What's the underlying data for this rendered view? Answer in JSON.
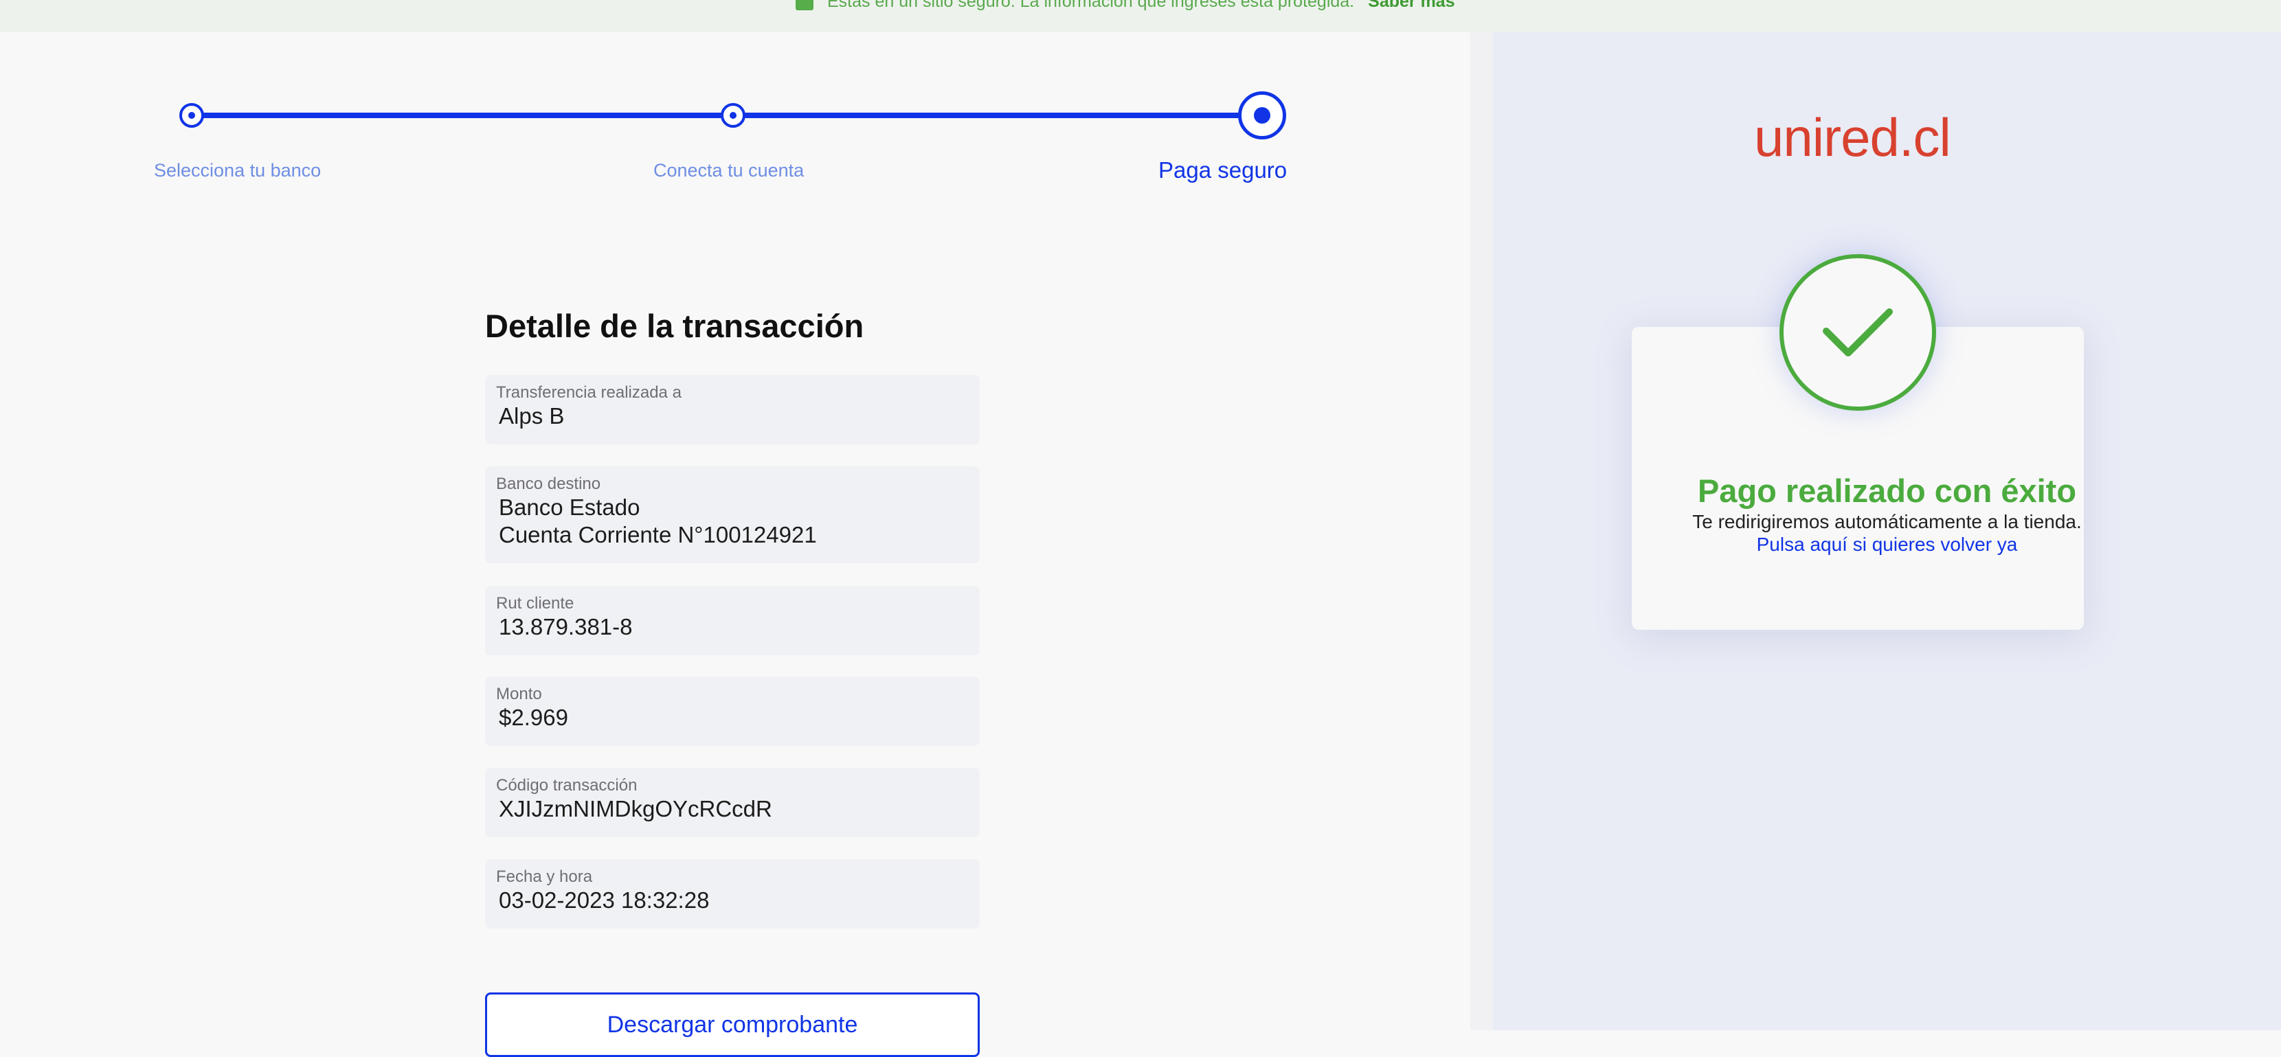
{
  "banner": {
    "text": "Estás en un sitio seguro. La información que ingreses está protegida.",
    "link_label": "Saber más",
    "icon": "lock-icon"
  },
  "stepper": {
    "steps": [
      {
        "label": "Selecciona tu banco",
        "state": "done"
      },
      {
        "label": "Conecta tu cuenta",
        "state": "done"
      },
      {
        "label": "Paga seguro",
        "state": "active"
      }
    ]
  },
  "detail": {
    "title": "Detalle de la transacción",
    "fields": [
      {
        "label": "Transferencia realizada a",
        "value": "Alps B"
      },
      {
        "label": "Banco destino",
        "value": "Banco Estado",
        "value2": "Cuenta Corriente N°100124921"
      },
      {
        "label": "Rut cliente",
        "value": "13.879.381-8"
      },
      {
        "label": "Monto",
        "value": "$2.969"
      },
      {
        "label": "Código transacción",
        "value": "XJIJzmNIMDkgOYcRCcdR"
      },
      {
        "label": "Fecha y hora",
        "value": "03-02-2023 18:32:28"
      }
    ],
    "download_label": "Descargar comprobante"
  },
  "merchant": {
    "logo_text": "unired.cl",
    "logo_color": "#d8412f"
  },
  "result": {
    "icon": "check-icon",
    "title": "Pago realizado con éxito",
    "redirect_text": "Te redirigiremos automáticamente a la tienda.",
    "redirect_link": "Pulsa aquí si quieres volver ya",
    "success_color": "#4bab3e"
  },
  "colors": {
    "accent": "#1034e6",
    "success": "#4bab3e",
    "brand": "#d8412f"
  }
}
